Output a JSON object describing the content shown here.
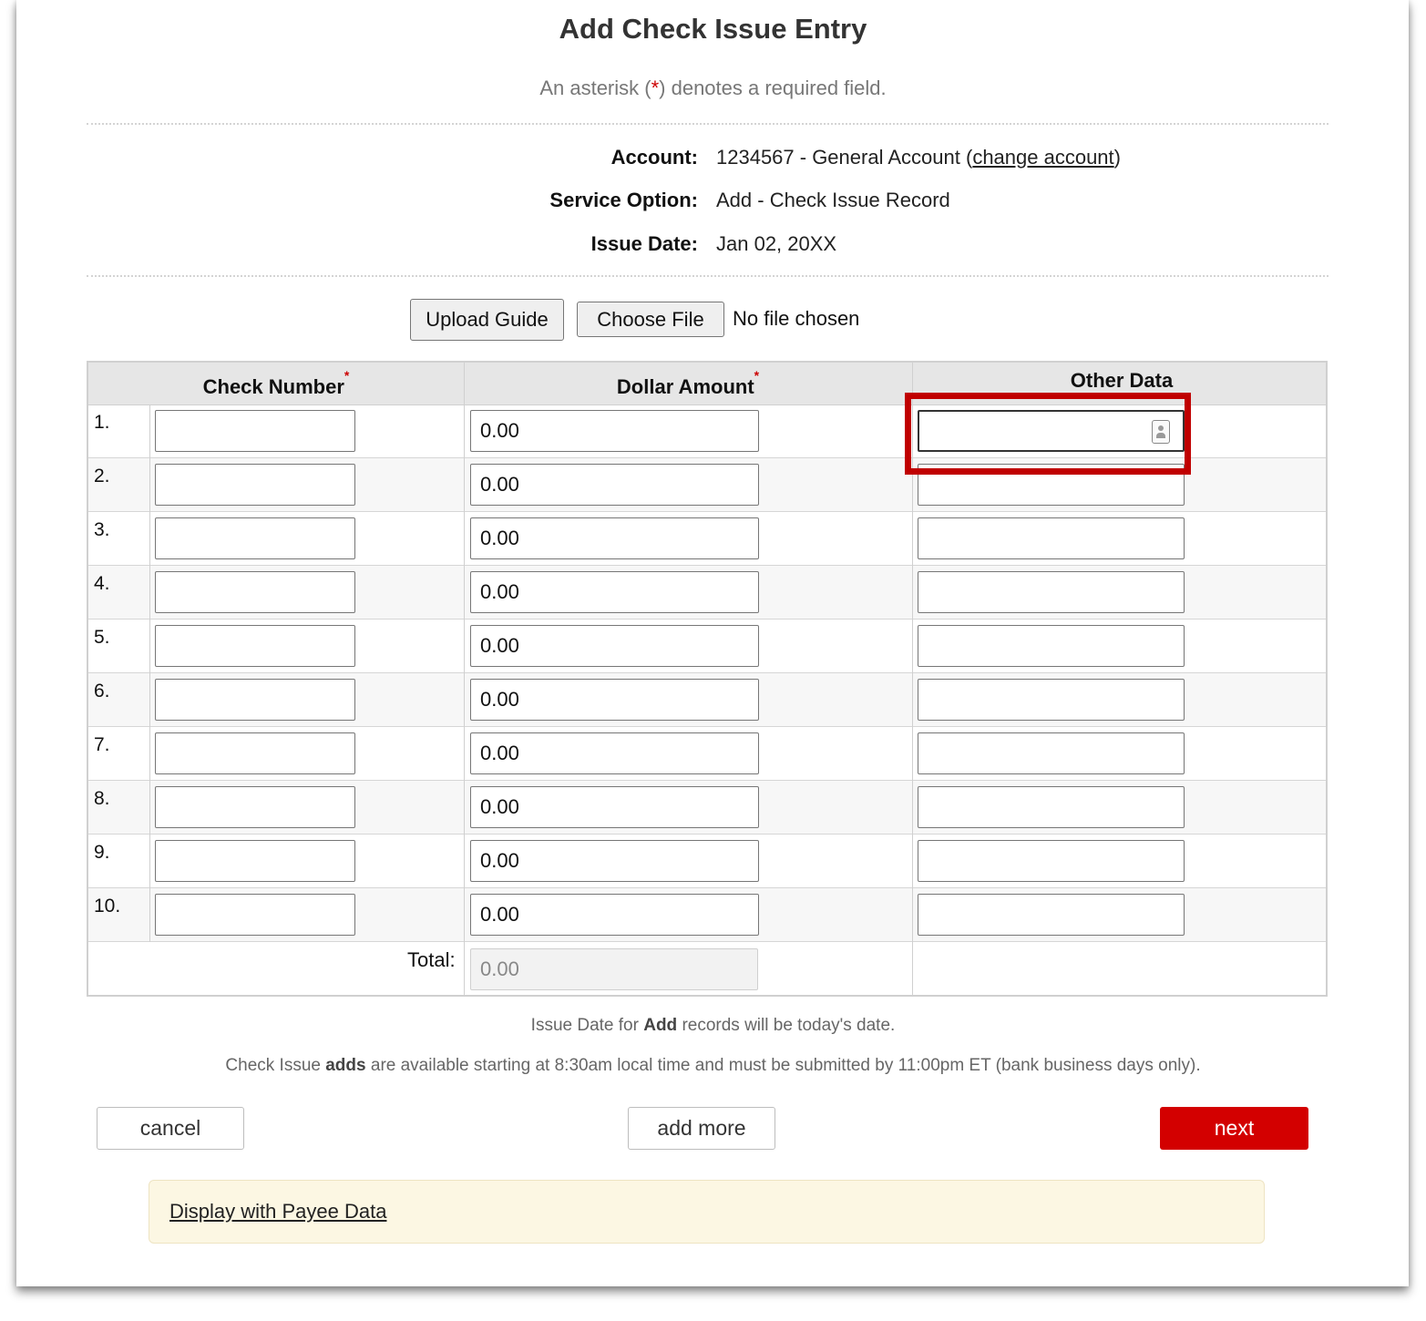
{
  "page": {
    "title": "Add Check Issue Entry",
    "required_note_prefix": "An asterisk (",
    "required_note_asterisk": "*",
    "required_note_suffix": ") denotes a required field."
  },
  "info": {
    "account_label": "Account:",
    "account_value": "1234567 - General Account",
    "account_link_open": " (",
    "change_account_link": "change account",
    "account_link_close": ")",
    "service_option_label": "Service Option:",
    "service_option_value": "Add - Check Issue Record",
    "issue_date_label": "Issue Date:",
    "issue_date_value": "Jan 02, 20XX"
  },
  "upload": {
    "upload_guide_label": "Upload Guide",
    "choose_file_label": "Choose File",
    "file_status": "No file chosen"
  },
  "table": {
    "headers": {
      "check_number": "Check Number",
      "dollar_amount": "Dollar Amount",
      "other_data": "Other Data",
      "required_marker": "*"
    },
    "rows": [
      {
        "num": "1.",
        "check_number": "",
        "dollar_amount": "0.00",
        "other_data": ""
      },
      {
        "num": "2.",
        "check_number": "",
        "dollar_amount": "0.00",
        "other_data": ""
      },
      {
        "num": "3.",
        "check_number": "",
        "dollar_amount": "0.00",
        "other_data": ""
      },
      {
        "num": "4.",
        "check_number": "",
        "dollar_amount": "0.00",
        "other_data": ""
      },
      {
        "num": "5.",
        "check_number": "",
        "dollar_amount": "0.00",
        "other_data": ""
      },
      {
        "num": "6.",
        "check_number": "",
        "dollar_amount": "0.00",
        "other_data": ""
      },
      {
        "num": "7.",
        "check_number": "",
        "dollar_amount": "0.00",
        "other_data": ""
      },
      {
        "num": "8.",
        "check_number": "",
        "dollar_amount": "0.00",
        "other_data": ""
      },
      {
        "num": "9.",
        "check_number": "",
        "dollar_amount": "0.00",
        "other_data": ""
      },
      {
        "num": "10.",
        "check_number": "",
        "dollar_amount": "0.00",
        "other_data": ""
      }
    ],
    "total_label": "Total:",
    "total_value": "0.00"
  },
  "notes": {
    "note1_prefix": "Issue Date for ",
    "note1_bold": "Add",
    "note1_suffix": " records will be today's date.",
    "note2_prefix": "Check Issue ",
    "note2_bold": "adds",
    "note2_suffix": " are available starting at 8:30am local time and must be submitted by 11:00pm ET (bank business days only)."
  },
  "actions": {
    "cancel_label": "cancel",
    "add_more_label": "add more",
    "next_label": "next",
    "next_color": "#d30000"
  },
  "payee": {
    "link_label": "Display with Payee Data"
  },
  "annotation": {
    "highlight_color": "#c00000"
  },
  "icons": {
    "other_data_field_icon": "contact-card-icon"
  }
}
